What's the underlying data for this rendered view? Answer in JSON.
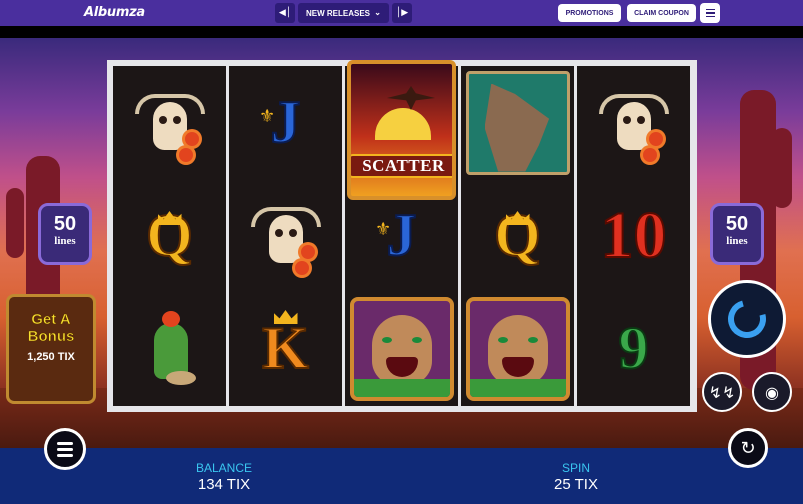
{
  "topbar": {
    "logo": "Albumza",
    "prev_icon": "skip-previous-icon",
    "category": "NEW RELEASES",
    "next_icon": "skip-next-icon",
    "promotions": "PROMOTIONS",
    "claim_coupon": "CLAIM COUPON",
    "menu_icon": "hamburger-menu-icon"
  },
  "game": {
    "lines_left": {
      "number": "50",
      "label": "lines"
    },
    "lines_right": {
      "number": "50",
      "label": "lines"
    },
    "bonus": {
      "title": "Get A Bonus",
      "price": "1,250 TIX"
    },
    "reels": [
      [
        "skull",
        "Q",
        "cactus"
      ],
      [
        "J",
        "skull",
        "K"
      ],
      [
        "scatter",
        "J",
        "cougar"
      ],
      [
        "wolf",
        "Q",
        "cougar"
      ],
      [
        "skull",
        "10",
        "9"
      ]
    ],
    "scatter_label": "SCATTER"
  },
  "controls": {
    "spin_icon": "spin-refresh-icon",
    "turbo_icon": "lightning-icon",
    "bet_icon": "coins-icon",
    "autoplay_icon": "autoplay-refresh-icon",
    "menu_icon": "hamburger-menu-icon"
  },
  "bottombar": {
    "balance_label": "BALANCE",
    "balance_value": "134 TIX",
    "spin_label": "SPIN",
    "spin_value": "25 TIX"
  },
  "colors": {
    "topbar": "#4a2f9e",
    "bottombar": "#102a78",
    "accent_cyan": "#3ac6f0"
  }
}
